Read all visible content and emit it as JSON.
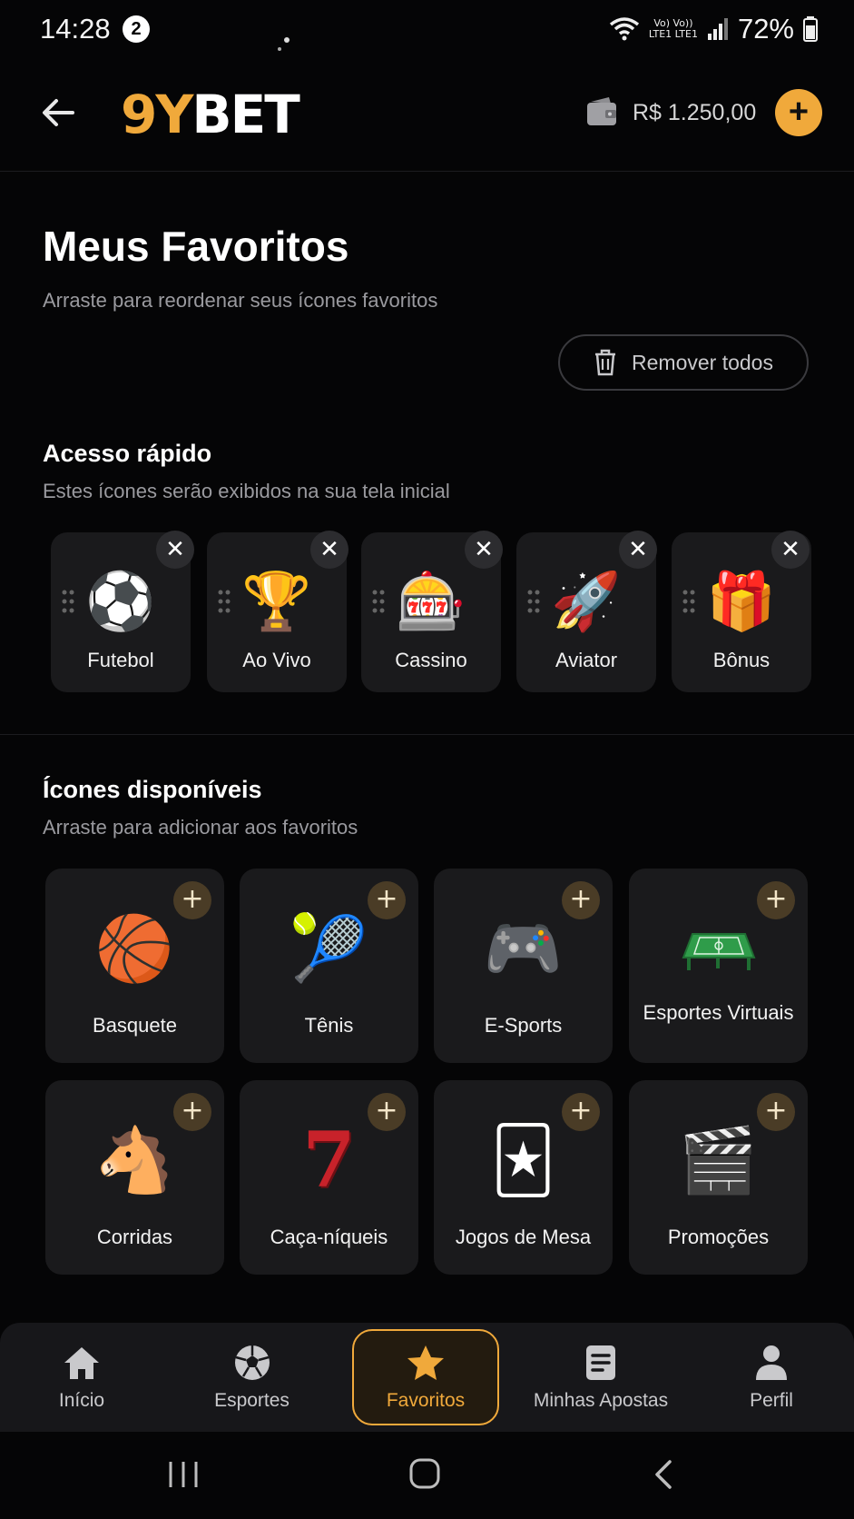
{
  "status_bar": {
    "time": "14:28",
    "notification_count": "2",
    "network_label_top": "Vo) Vo))",
    "network_label_bottom": "LTE1 LTE1",
    "battery": "72%"
  },
  "header": {
    "logo_part1": "9Y",
    "logo_part2": "BET",
    "balance": "R$ 1.250,00",
    "add_funds_symbol": "+"
  },
  "page": {
    "title": "Meus Favoritos",
    "subtitle": "Arraste para reordenar seus ícones favoritos",
    "remove_all_label": "Remover todos"
  },
  "quick_access": {
    "title": "Acesso rápido",
    "subtitle": "Estes ícones serão exibidos na sua tela inicial",
    "items": [
      {
        "label": "Futebol",
        "icon": "⚽"
      },
      {
        "label": "Ao Vivo",
        "icon": "🏆"
      },
      {
        "label": "Cassino",
        "icon": "🎰"
      },
      {
        "label": "Aviator",
        "icon": "🚀"
      },
      {
        "label": "Bônus",
        "icon": "🎁"
      }
    ],
    "remove_symbol": "✕"
  },
  "available": {
    "title": "Ícones disponíveis",
    "subtitle": "Arraste para adicionar aos favoritos",
    "items": [
      {
        "label": "Basquete",
        "icon": "🏀"
      },
      {
        "label": "Tênis",
        "icon": "🎾"
      },
      {
        "label": "E-Sports",
        "icon": "🎮"
      },
      {
        "label": "Esportes Virtuais",
        "icon": "🏟"
      },
      {
        "label": "Corridas",
        "icon": "🐴"
      },
      {
        "label": "Caça-níqueis",
        "icon": "7"
      },
      {
        "label": "Jogos de Mesa",
        "icon": "🃏"
      },
      {
        "label": "Promoções",
        "icon": "🎬"
      }
    ],
    "add_symbol": "+"
  },
  "bottom_nav": {
    "items": [
      {
        "label": "Início",
        "icon": "home-icon"
      },
      {
        "label": "Esportes",
        "icon": "soccer-ball-icon"
      },
      {
        "label": "Favoritos",
        "icon": "star-icon"
      },
      {
        "label": "Minhas Apostas",
        "icon": "document-icon"
      },
      {
        "label": "Perfil",
        "icon": "user-icon"
      }
    ],
    "active": "Favoritos"
  },
  "colors": {
    "accent": "#f0a93b",
    "background": "#050506",
    "card": "#1a1a1c"
  }
}
